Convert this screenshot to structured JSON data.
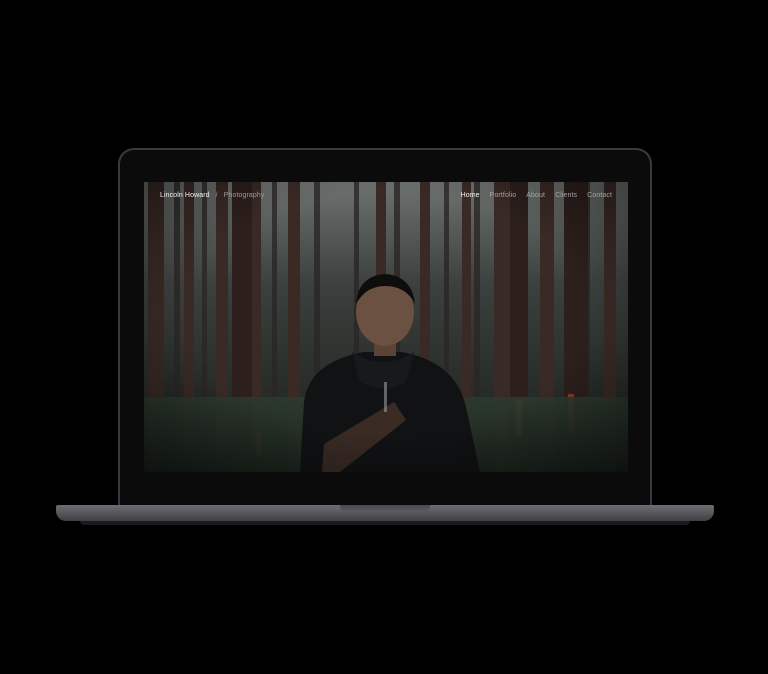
{
  "site": {
    "brand_name": "Lincoln Howard",
    "brand_separator": "/",
    "brand_tagline": "Photography",
    "nav": [
      {
        "label": "Home",
        "active": true
      },
      {
        "label": "Portfolio",
        "active": false
      },
      {
        "label": "About",
        "active": false
      },
      {
        "label": "Clients",
        "active": false
      },
      {
        "label": "Contact",
        "active": false
      }
    ]
  },
  "hero": {
    "image_icon": "forest-portrait-photo"
  },
  "colors": {
    "page_background": "#000000",
    "laptop_body": "#5a5a5e",
    "nav_active": "#f4f4f4",
    "nav_inactive": "#a4a4a4"
  }
}
